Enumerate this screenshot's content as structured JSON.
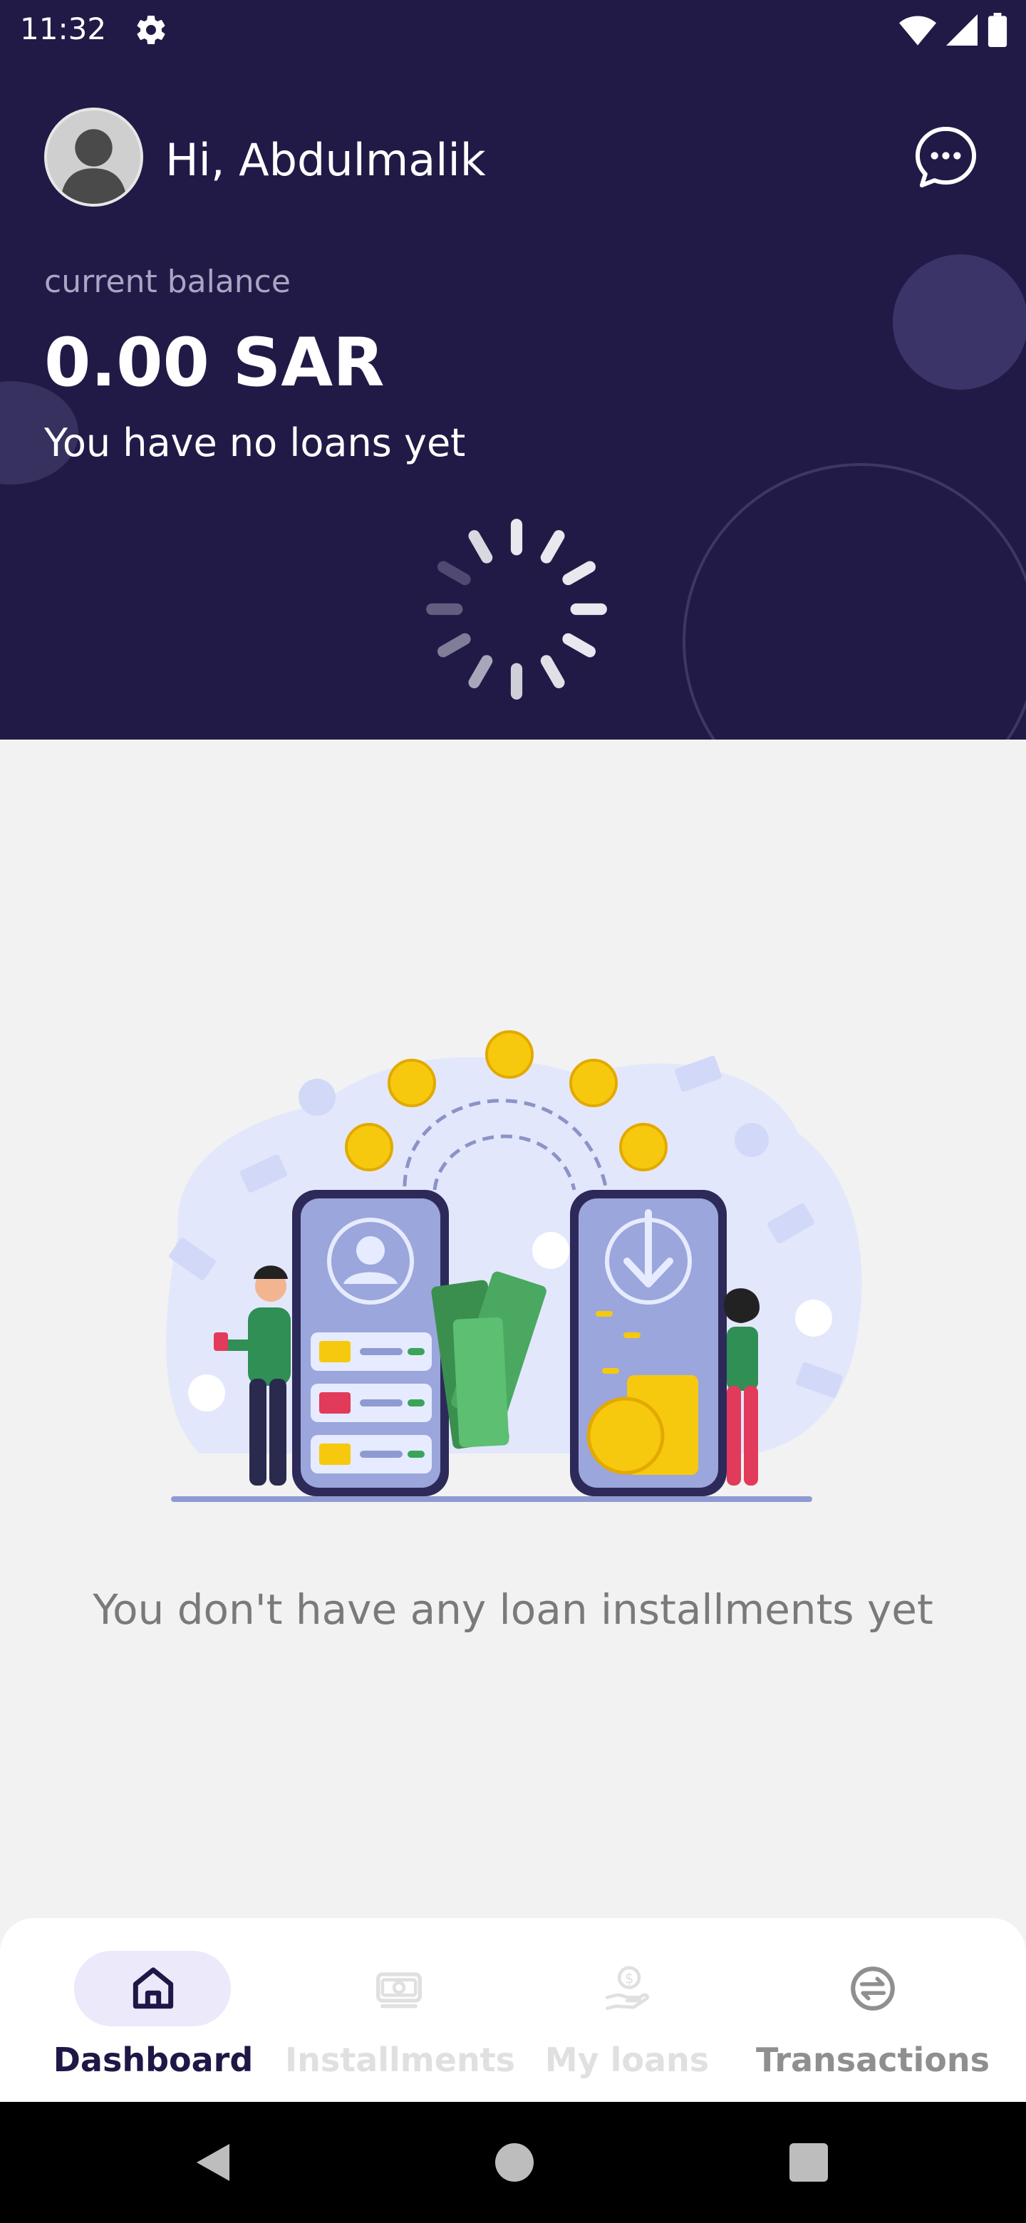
{
  "status_bar": {
    "time": "11:32"
  },
  "header": {
    "greeting": "Hi, Abdulmalik",
    "balance_label": "current balance",
    "balance_value": "0.00 SAR",
    "loans_status": "You have no loans yet"
  },
  "empty_state": {
    "message": "You don't have any loan installments yet"
  },
  "bottom_nav": {
    "items": [
      {
        "label": "Dashboard",
        "icon": "home-icon",
        "state": "active"
      },
      {
        "label": "Installments",
        "icon": "money-icon",
        "state": "disabled"
      },
      {
        "label": "My loans",
        "icon": "hand-coin-icon",
        "state": "disabled"
      },
      {
        "label": "Transactions",
        "icon": "exchange-icon",
        "state": "inactive"
      }
    ]
  },
  "colors": {
    "header_bg": "#211a47",
    "page_bg": "#f2f2f2",
    "active_pill": "#ece9fb",
    "active_text": "#1d1846",
    "disabled_text": "#e0e0e0",
    "inactive_text": "#8f8f8f"
  }
}
